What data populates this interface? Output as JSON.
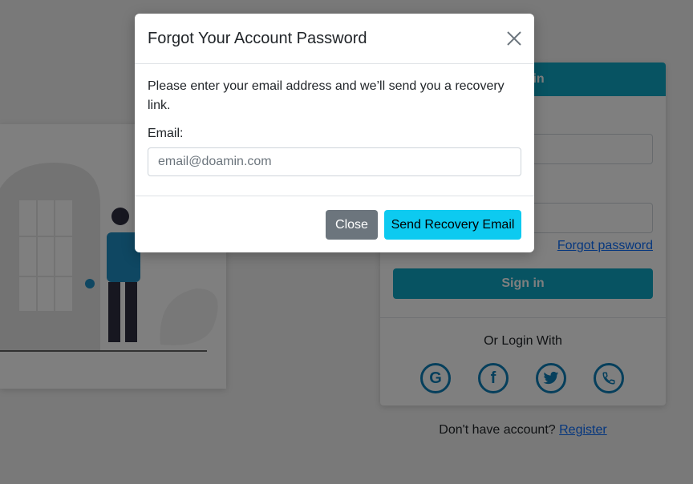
{
  "login": {
    "header": "Sign in",
    "forgot_link": "Forgot password",
    "signin_button": "Sign in",
    "or_login_with": "Or Login With",
    "social_icons": [
      "google-icon",
      "facebook-icon",
      "twitter-icon",
      "phone-icon"
    ],
    "no_account_text": "Don't have account?",
    "register_link": "Register"
  },
  "modal": {
    "title": "Forgot Your Account Password",
    "close_icon": "close-icon",
    "message": "Please enter your email address and we’ll send you a recovery link.",
    "email_label": "Email:",
    "email_placeholder": "email@doamin.com",
    "close_button": "Close",
    "send_button": "Send Recovery Email"
  },
  "colors": {
    "accent": "#0fa6c4",
    "send_button": "#0dcaf0",
    "close_button": "#6c757d",
    "link": "#0d6efd"
  }
}
